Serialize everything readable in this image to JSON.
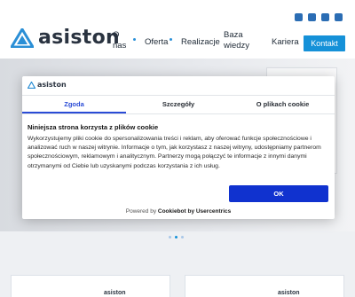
{
  "header": {
    "logo_text": "asiston",
    "nav": [
      {
        "label_line1": "O",
        "label_line2": "nas"
      },
      {
        "label": "Oferta"
      },
      {
        "label": "Realizacje"
      },
      {
        "label_line1": "Baza",
        "label_line2": "wiedzy"
      },
      {
        "label": "Kariera"
      }
    ],
    "contact_label": "Kontakt",
    "social_icons": [
      "facebook-icon",
      "linkedin-icon",
      "mail-icon",
      "instagram-icon"
    ]
  },
  "cookie_dialog": {
    "logo_text": "asiston",
    "tabs": [
      "Zgoda",
      "Szczegóły",
      "O plikach cookie"
    ],
    "active_tab": "Zgoda",
    "heading": "Niniejsza strona korzysta z plików cookie",
    "body": "Wykorzystujemy pliki cookie do spersonalizowania treści i reklam, aby oferować funkcje społecznościowe i analizować ruch w naszej witrynie. Informacje o tym, jak korzystasz z naszej witryny, udostępniamy partnerom społecznościowym, reklamowym i analitycznym. Partnerzy mogą połączyć te informacje z innymi danymi otrzymanymi od Ciebie lub uzyskanymi podczas korzystania z ich usług.",
    "ok_label": "OK",
    "powered_prefix": "Powered by ",
    "powered_brand": "Cookiebot by Usercentrics"
  },
  "cards": [
    {
      "logo_text": "asiston"
    },
    {
      "logo_text": "asiston"
    }
  ],
  "colors": {
    "accent": "#1591d8",
    "ok_button": "#1032cf",
    "active_tab": "#2a4bd6",
    "logo_mark": "#2b8fd6"
  }
}
